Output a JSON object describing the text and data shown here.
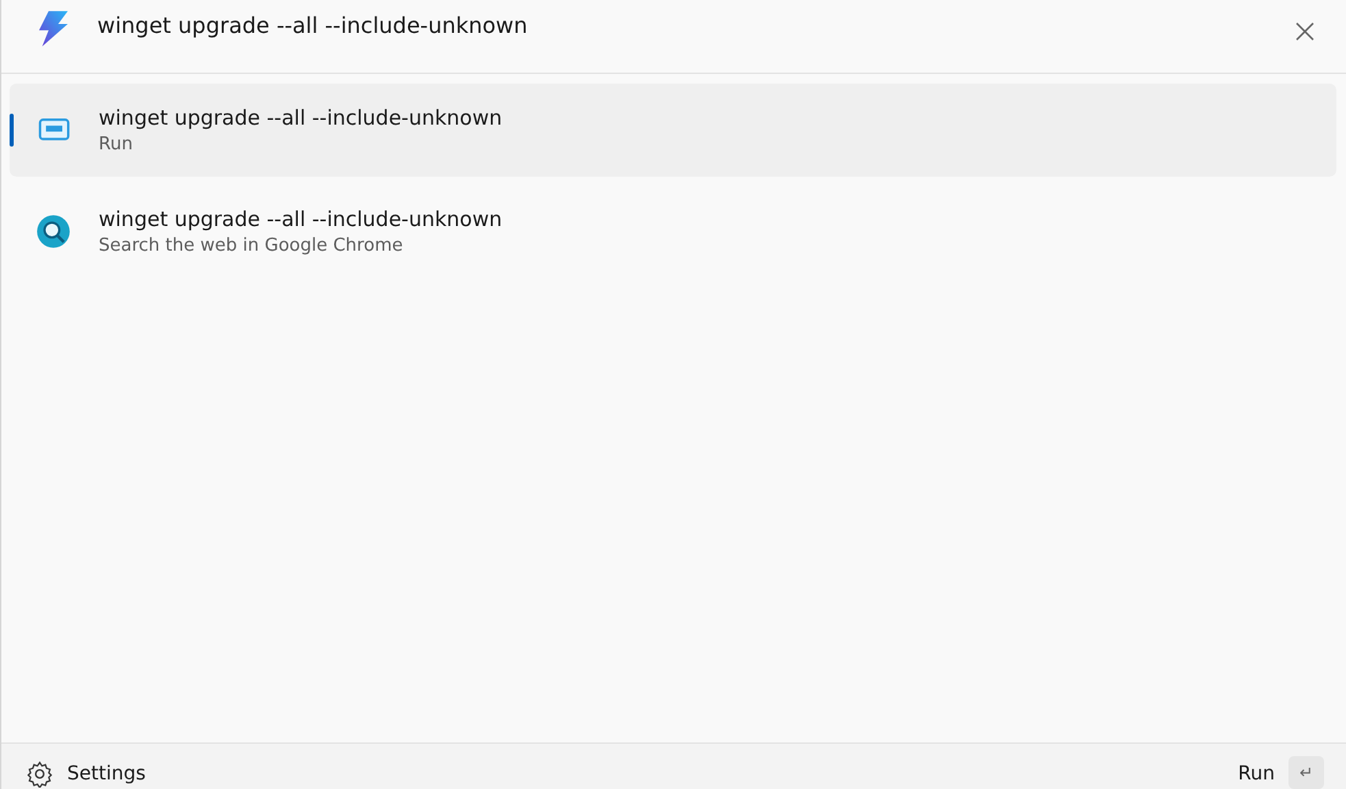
{
  "search": {
    "value": "winget upgrade --all --include-unknown"
  },
  "results": [
    {
      "kind": "run",
      "title": "winget upgrade --all --include-unknown",
      "subtitle": "Run",
      "selected": true
    },
    {
      "kind": "web",
      "title": "winget upgrade --all --include-unknown",
      "subtitle": "Search the web in Google Chrome",
      "selected": false
    }
  ],
  "footer": {
    "settings": "Settings",
    "action": "Run",
    "key": "↵"
  }
}
